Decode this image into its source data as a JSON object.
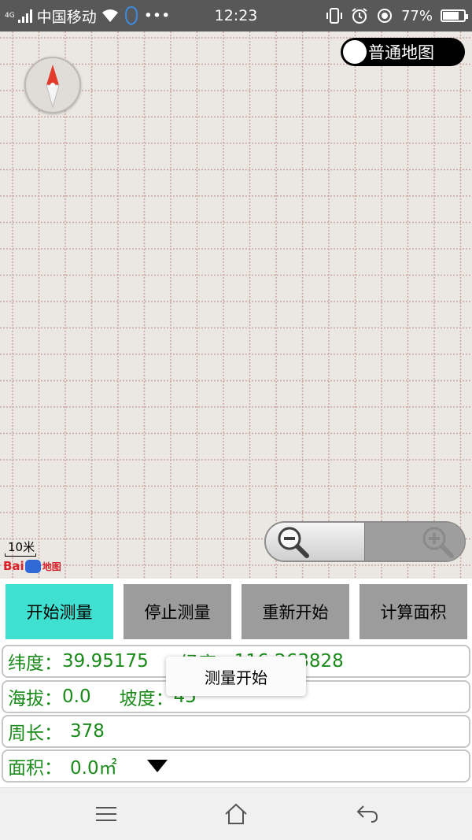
{
  "status_bar": {
    "network_type": "4G",
    "network_type_top": "4G",
    "carrier": "中国移动",
    "dots": "•••",
    "time": "12:23",
    "battery_percent": "77%",
    "battery_level": 0.77,
    "icons": [
      "signal-icon",
      "wifi-icon",
      "notification-icon",
      "vibrate-icon",
      "alarm-icon",
      "location-icon",
      "battery-icon"
    ]
  },
  "map": {
    "type_toggle_label": "普通地图",
    "scale_label": "10米",
    "logo_text": "Bai",
    "logo_suffix": "地图",
    "background_color": "#ebe7e2",
    "grid_line_color": "#c9a9a2"
  },
  "buttons": {
    "start_label": "开始测量",
    "stop_label": "停止测量",
    "restart_label": "重新开始",
    "calc_label": "计算面积",
    "active_color": "#40e0d0",
    "inactive_color": "#9c9c9c"
  },
  "info": {
    "lat_label": "纬度：",
    "lat_value": "39.95175",
    "lng_label": "经度：",
    "lng_value": "116.263828",
    "alt_label": "海拔：",
    "alt_value": "0.0",
    "slope_label": "坡度：",
    "slope_value": "45",
    "perimeter_label": "周长：",
    "perimeter_value": "378",
    "area_label": "面积：",
    "area_value": "0.0㎡",
    "text_color": "#1a8b1a"
  },
  "toast": {
    "message": "测量开始"
  },
  "nav_bar": {
    "icons": [
      "menu-icon",
      "home-icon",
      "back-icon"
    ]
  }
}
